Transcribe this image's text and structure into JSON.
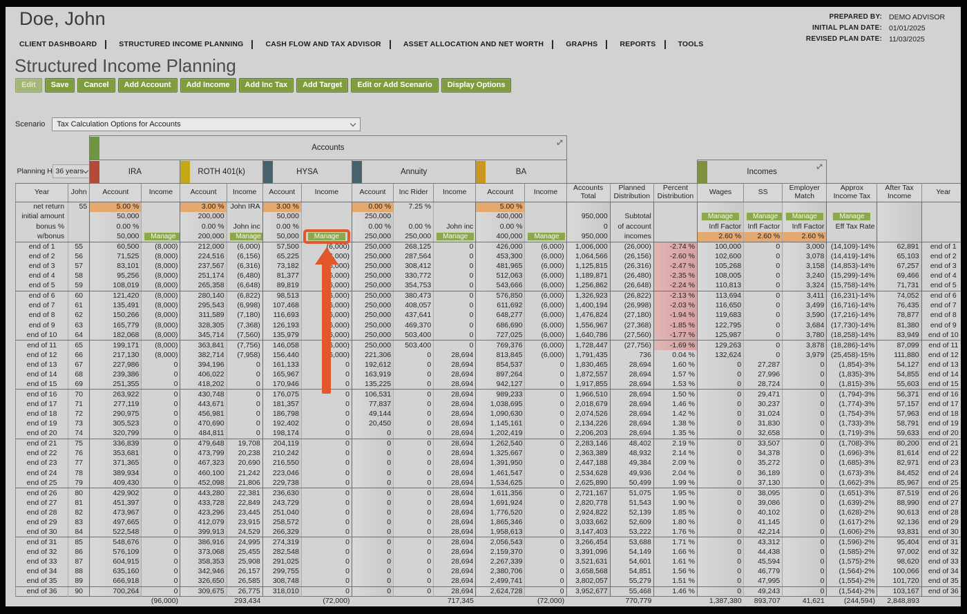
{
  "window": {
    "title": "Doe, John"
  },
  "plan_meta": {
    "prepared_by_label": "PREPARED BY:",
    "prepared_by": "DEMO ADVISOR",
    "initial_plan_label": "INITIAL PLAN DATE:",
    "initial_plan_date": "01/01/2025",
    "revised_plan_label": "REVISED PLAN DATE:",
    "revised_plan_date": "11/03/2025"
  },
  "nav": {
    "items": [
      "CLIENT DASHBOARD",
      "STRUCTURED INCOME PLANNING",
      "CASH FLOW AND TAX ADVISOR",
      "ASSET ALLOCATION AND NET WORTH",
      "GRAPHS",
      "REPORTS",
      "TOOLS"
    ]
  },
  "page": {
    "title": "Structured Income Planning"
  },
  "toolbar": {
    "buttons": [
      {
        "label": "Edit",
        "disabled": true
      },
      {
        "label": "Save",
        "disabled": false
      },
      {
        "label": "Cancel",
        "disabled": false
      },
      {
        "label": "Add Account",
        "disabled": false
      },
      {
        "label": "Add Income",
        "disabled": false
      },
      {
        "label": "Add Inc Tax",
        "disabled": false
      },
      {
        "label": "Add Target",
        "disabled": false
      },
      {
        "label": "Edit or Add Scenario",
        "disabled": false
      },
      {
        "label": "Display Options",
        "disabled": false
      }
    ]
  },
  "scenario": {
    "label": "Scenario",
    "value": "Tax Calculation Options for Accounts"
  },
  "planning_horizon": {
    "label": "Planning Horizon",
    "value": "36 years"
  },
  "table": {
    "accounts_group_label": "Accounts",
    "incomes_group_label": "Incomes",
    "account_names": [
      "IRA",
      "ROTH 401(k)",
      "HYSA",
      "Annuity",
      "BA"
    ],
    "column_headers": [
      "Year",
      "John",
      "Account",
      "Income",
      "Account",
      "Income",
      "Account",
      "Income",
      "Account",
      "Inc Rider",
      "Income",
      "Account",
      "Income",
      "Accounts Total",
      "Planned Distribution",
      "Percent Distribution",
      "Wages",
      "SS",
      "Employer Match",
      "Approx Income Tax",
      "After Tax Income",
      "Year"
    ],
    "manage_label": "Manage",
    "special_rows": [
      [
        "net return",
        "55",
        "5.00 %",
        "",
        "3.00 %",
        "John IRA",
        "3.00 %",
        "",
        "0.00 %",
        "7.25 %",
        "",
        "5.00 %",
        "",
        "",
        "",
        "",
        "",
        "",
        "",
        "",
        "",
        ""
      ],
      [
        "initial amount",
        "",
        "50,000",
        "",
        "200,000",
        "",
        "50,000",
        "",
        "250,000",
        "",
        "",
        "400,000",
        "",
        "950,000",
        "Subtotal",
        "",
        "Manage",
        "Manage",
        "Manage",
        "Manage",
        "",
        ""
      ],
      [
        "bonus %",
        "",
        "0.00 %",
        "",
        "0.00 %",
        "John inc",
        "0.00 %",
        "",
        "0.00 %",
        "0.00 %",
        "John inc",
        "0.00 %",
        "",
        "0",
        "of account",
        "",
        "Infl Factor",
        "Infl Factor",
        "Infl Factor",
        "Eff Tax Rate",
        "",
        ""
      ],
      [
        "w/bonus",
        "",
        "50,000",
        "Manage",
        "200,000",
        "Manage",
        "50,000",
        "Manage",
        "250,000",
        "250,000",
        "Manage",
        "400,000",
        "Manage",
        "950,000",
        "incomes",
        "",
        "2.60 %",
        "2.60 %",
        "2.60 %",
        "",
        "",
        ""
      ]
    ],
    "rows": [
      [
        "end of 1",
        "55",
        "60,500",
        "(8,000)",
        "212,000",
        "(6,000)",
        "57,500",
        "(6,000)",
        "250,000",
        "268,125",
        "0",
        "426,000",
        "(6,000)",
        "1,006,000",
        "(26,000)",
        "-2.74 %",
        "100,000",
        "0",
        "3,000",
        "(14,109)-14%",
        "62,891",
        "end of 1"
      ],
      [
        "end of 2",
        "56",
        "71,525",
        "(8,000)",
        "224,516",
        "(6,156)",
        "65,225",
        "(6,000)",
        "250,000",
        "287,564",
        "0",
        "453,300",
        "(6,000)",
        "1,064,566",
        "(26,156)",
        "-2.60 %",
        "102,600",
        "0",
        "3,078",
        "(14,419)-14%",
        "65,103",
        "end of 2"
      ],
      [
        "end of 3",
        "57",
        "83,101",
        "(8,000)",
        "237,567",
        "(6,316)",
        "73,182",
        "(6,000)",
        "250,000",
        "308,412",
        "0",
        "481,965",
        "(6,000)",
        "1,125,815",
        "(26,316)",
        "-2.47 %",
        "105,268",
        "0",
        "3,158",
        "(14,853)-14%",
        "67,257",
        "end of 3"
      ],
      [
        "end of 4",
        "58",
        "95,256",
        "(8,000)",
        "251,174",
        "(6,480)",
        "81,377",
        "(6,000)",
        "250,000",
        "330,772",
        "0",
        "512,063",
        "(6,000)",
        "1,189,871",
        "(26,480)",
        "-2.35 %",
        "108,005",
        "0",
        "3,240",
        "(15,299)-14%",
        "69,466",
        "end of 4"
      ],
      [
        "end of 5",
        "59",
        "108,019",
        "(8,000)",
        "265,358",
        "(6,648)",
        "89,819",
        "(6,000)",
        "250,000",
        "354,753",
        "0",
        "543,666",
        "(6,000)",
        "1,256,862",
        "(26,648)",
        "-2.24 %",
        "110,813",
        "0",
        "3,324",
        "(15,758)-14%",
        "71,731",
        "end of 5"
      ],
      [
        "end of 6",
        "60",
        "121,420",
        "(8,000)",
        "280,140",
        "(6,822)",
        "98,513",
        "(6,000)",
        "250,000",
        "380,473",
        "0",
        "576,850",
        "(6,000)",
        "1,326,923",
        "(26,822)",
        "-2.13 %",
        "113,694",
        "0",
        "3,411",
        "(16,231)-14%",
        "74,052",
        "end of 6"
      ],
      [
        "end of 7",
        "61",
        "135,491",
        "(8,000)",
        "295,543",
        "(6,998)",
        "107,468",
        "(6,000)",
        "250,000",
        "408,057",
        "0",
        "611,692",
        "(6,000)",
        "1,400,194",
        "(26,998)",
        "-2.03 %",
        "116,650",
        "0",
        "3,499",
        "(16,716)-14%",
        "76,435",
        "end of 7"
      ],
      [
        "end of 8",
        "62",
        "150,266",
        "(8,000)",
        "311,589",
        "(7,180)",
        "116,693",
        "(6,000)",
        "250,000",
        "437,641",
        "0",
        "648,277",
        "(6,000)",
        "1,476,824",
        "(27,180)",
        "-1.94 %",
        "119,683",
        "0",
        "3,590",
        "(17,216)-14%",
        "78,877",
        "end of 8"
      ],
      [
        "end of 9",
        "63",
        "165,779",
        "(8,000)",
        "328,305",
        "(7,368)",
        "126,193",
        "(6,000)",
        "250,000",
        "469,370",
        "0",
        "686,690",
        "(6,000)",
        "1,556,967",
        "(27,368)",
        "-1.85 %",
        "122,795",
        "0",
        "3,684",
        "(17,730)-14%",
        "81,380",
        "end of 9"
      ],
      [
        "end of 10",
        "64",
        "182,068",
        "(8,000)",
        "345,714",
        "(7,560)",
        "135,979",
        "(6,000)",
        "250,000",
        "503,400",
        "0",
        "727,025",
        "(6,000)",
        "1,640,786",
        "(27,560)",
        "-1.77 %",
        "125,987",
        "0",
        "3,780",
        "(18,258)-14%",
        "83,949",
        "end of 10"
      ],
      [
        "end of 11",
        "65",
        "199,171",
        "(8,000)",
        "363,841",
        "(7,756)",
        "146,058",
        "(6,000)",
        "250,000",
        "503,400",
        "0",
        "769,376",
        "(6,000)",
        "1,728,447",
        "(27,756)",
        "-1.69 %",
        "129,263",
        "0",
        "3,878",
        "(18,286)-14%",
        "87,099",
        "end of 11"
      ],
      [
        "end of 12",
        "66",
        "217,130",
        "(8,000)",
        "382,714",
        "(7,958)",
        "156,440",
        "(6,000)",
        "221,306",
        "0",
        "28,694",
        "813,845",
        "(6,000)",
        "1,791,435",
        "736",
        "0.04 %",
        "132,624",
        "0",
        "3,979",
        "(25,458)-15%",
        "111,880",
        "end of 12"
      ],
      [
        "end of 13",
        "67",
        "227,986",
        "0",
        "394,196",
        "0",
        "161,133",
        "0",
        "192,612",
        "0",
        "28,694",
        "854,537",
        "0",
        "1,830,465",
        "28,694",
        "1.60 %",
        "0",
        "27,287",
        "0",
        "(1,854)-3%",
        "54,127",
        "end of 13"
      ],
      [
        "end of 14",
        "68",
        "239,386",
        "0",
        "406,022",
        "0",
        "165,967",
        "0",
        "163,919",
        "0",
        "28,694",
        "897,264",
        "0",
        "1,872,557",
        "28,694",
        "1.57 %",
        "0",
        "27,996",
        "0",
        "(1,835)-3%",
        "54,855",
        "end of 14"
      ],
      [
        "end of 15",
        "69",
        "251,355",
        "0",
        "418,202",
        "0",
        "170,946",
        "0",
        "135,225",
        "0",
        "28,694",
        "942,127",
        "0",
        "1,917,855",
        "28,694",
        "1.53 %",
        "0",
        "28,724",
        "0",
        "(1,815)-3%",
        "55,603",
        "end of 15"
      ],
      [
        "end of 16",
        "70",
        "263,922",
        "0",
        "430,748",
        "0",
        "176,075",
        "0",
        "106,531",
        "0",
        "28,694",
        "989,233",
        "0",
        "1,966,510",
        "28,694",
        "1.50 %",
        "0",
        "29,471",
        "0",
        "(1,794)-3%",
        "56,371",
        "end of 16"
      ],
      [
        "end of 17",
        "71",
        "277,119",
        "0",
        "443,671",
        "0",
        "181,357",
        "0",
        "77,837",
        "0",
        "28,694",
        "1,038,695",
        "0",
        "2,018,679",
        "28,694",
        "1.46 %",
        "0",
        "30,237",
        "0",
        "(1,774)-3%",
        "57,157",
        "end of 17"
      ],
      [
        "end of 18",
        "72",
        "290,975",
        "0",
        "456,981",
        "0",
        "186,798",
        "0",
        "49,144",
        "0",
        "28,694",
        "1,090,630",
        "0",
        "2,074,526",
        "28,694",
        "1.42 %",
        "0",
        "31,024",
        "0",
        "(1,754)-3%",
        "57,963",
        "end of 18"
      ],
      [
        "end of 19",
        "73",
        "305,523",
        "0",
        "470,690",
        "0",
        "192,402",
        "0",
        "20,450",
        "0",
        "28,694",
        "1,145,161",
        "0",
        "2,134,226",
        "28,694",
        "1.38 %",
        "0",
        "31,830",
        "0",
        "(1,733)-3%",
        "58,791",
        "end of 19"
      ],
      [
        "end of 20",
        "74",
        "320,799",
        "0",
        "484,811",
        "0",
        "198,174",
        "0",
        "0",
        "0",
        "28,694",
        "1,202,419",
        "0",
        "2,206,203",
        "28,694",
        "1.35 %",
        "0",
        "32,658",
        "0",
        "(1,719)-3%",
        "59,633",
        "end of 20"
      ],
      [
        "end of 21",
        "75",
        "336,839",
        "0",
        "479,648",
        "19,708",
        "204,119",
        "0",
        "0",
        "0",
        "28,694",
        "1,262,540",
        "0",
        "2,283,146",
        "48,402",
        "2.19 %",
        "0",
        "33,507",
        "0",
        "(1,708)-3%",
        "80,200",
        "end of 21"
      ],
      [
        "end of 22",
        "76",
        "353,681",
        "0",
        "473,799",
        "20,238",
        "210,242",
        "0",
        "0",
        "0",
        "28,694",
        "1,325,667",
        "0",
        "2,363,389",
        "48,932",
        "2.14 %",
        "0",
        "34,378",
        "0",
        "(1,696)-3%",
        "81,614",
        "end of 22"
      ],
      [
        "end of 23",
        "77",
        "371,365",
        "0",
        "467,323",
        "20,690",
        "216,550",
        "0",
        "0",
        "0",
        "28,694",
        "1,391,950",
        "0",
        "2,447,188",
        "49,384",
        "2.09 %",
        "0",
        "35,272",
        "0",
        "(1,685)-3%",
        "82,971",
        "end of 23"
      ],
      [
        "end of 24",
        "78",
        "389,934",
        "0",
        "460,100",
        "21,242",
        "223,046",
        "0",
        "0",
        "0",
        "28,694",
        "1,461,547",
        "0",
        "2,534,628",
        "49,936",
        "2.04 %",
        "0",
        "36,189",
        "0",
        "(1,673)-3%",
        "84,452",
        "end of 24"
      ],
      [
        "end of 25",
        "79",
        "409,430",
        "0",
        "452,098",
        "21,806",
        "229,738",
        "0",
        "0",
        "0",
        "28,694",
        "1,534,625",
        "0",
        "2,625,890",
        "50,499",
        "1.99 %",
        "0",
        "37,130",
        "0",
        "(1,662)-3%",
        "85,967",
        "end of 25"
      ],
      [
        "end of 26",
        "80",
        "429,902",
        "0",
        "443,280",
        "22,381",
        "236,630",
        "0",
        "0",
        "0",
        "28,694",
        "1,611,356",
        "0",
        "2,721,167",
        "51,075",
        "1.95 %",
        "0",
        "38,095",
        "0",
        "(1,651)-3%",
        "87,519",
        "end of 26"
      ],
      [
        "end of 27",
        "81",
        "451,397",
        "0",
        "433,728",
        "22,849",
        "243,729",
        "0",
        "0",
        "0",
        "28,694",
        "1,691,924",
        "0",
        "2,820,778",
        "51,543",
        "1.90 %",
        "0",
        "39,086",
        "0",
        "(1,639)-2%",
        "88,990",
        "end of 27"
      ],
      [
        "end of 28",
        "82",
        "473,967",
        "0",
        "423,296",
        "23,445",
        "251,040",
        "0",
        "0",
        "0",
        "28,694",
        "1,776,520",
        "0",
        "2,924,822",
        "52,139",
        "1.85 %",
        "0",
        "40,102",
        "0",
        "(1,628)-2%",
        "90,613",
        "end of 28"
      ],
      [
        "end of 29",
        "83",
        "497,665",
        "0",
        "412,079",
        "23,915",
        "258,572",
        "0",
        "0",
        "0",
        "28,694",
        "1,865,346",
        "0",
        "3,033,662",
        "52,609",
        "1.80 %",
        "0",
        "41,145",
        "0",
        "(1,617)-2%",
        "92,136",
        "end of 29"
      ],
      [
        "end of 30",
        "84",
        "522,548",
        "0",
        "399,913",
        "24,529",
        "266,329",
        "0",
        "0",
        "0",
        "28,694",
        "1,958,613",
        "0",
        "3,147,403",
        "53,222",
        "1.76 %",
        "0",
        "42,214",
        "0",
        "(1,606)-2%",
        "93,831",
        "end of 30"
      ],
      [
        "end of 31",
        "85",
        "548,676",
        "0",
        "386,916",
        "24,995",
        "274,319",
        "0",
        "0",
        "0",
        "28,694",
        "2,056,543",
        "0",
        "3,266,454",
        "53,688",
        "1.71 %",
        "0",
        "43,312",
        "0",
        "(1,596)-2%",
        "95,404",
        "end of 31"
      ],
      [
        "end of 32",
        "86",
        "576,109",
        "0",
        "373,068",
        "25,455",
        "282,548",
        "0",
        "0",
        "0",
        "28,694",
        "2,159,370",
        "0",
        "3,391,096",
        "54,149",
        "1.66 %",
        "0",
        "44,438",
        "0",
        "(1,585)-2%",
        "97,002",
        "end of 32"
      ],
      [
        "end of 33",
        "87",
        "604,915",
        "0",
        "358,353",
        "25,908",
        "291,025",
        "0",
        "0",
        "0",
        "28,694",
        "2,267,339",
        "0",
        "3,521,631",
        "54,601",
        "1.61 %",
        "0",
        "45,594",
        "0",
        "(1,575)-2%",
        "98,620",
        "end of 33"
      ],
      [
        "end of 34",
        "88",
        "635,160",
        "0",
        "342,946",
        "26,157",
        "299,755",
        "0",
        "0",
        "0",
        "28,694",
        "2,380,706",
        "0",
        "3,658,568",
        "54,851",
        "1.56 %",
        "0",
        "46,779",
        "0",
        "(1,564)-2%",
        "100,066",
        "end of 34"
      ],
      [
        "end of 35",
        "89",
        "666,918",
        "0",
        "326,650",
        "26,585",
        "308,748",
        "0",
        "0",
        "0",
        "28,694",
        "2,499,741",
        "0",
        "3,802,057",
        "55,279",
        "1.51 %",
        "0",
        "47,995",
        "0",
        "(1,554)-2%",
        "101,720",
        "end of 35"
      ],
      [
        "end of 36",
        "90",
        "700,264",
        "0",
        "309,675",
        "26,775",
        "318,010",
        "0",
        "0",
        "0",
        "28,694",
        "2,624,728",
        "0",
        "3,952,677",
        "55,468",
        "1.46 %",
        "0",
        "49,243",
        "0",
        "(1,544)-2%",
        "103,167",
        "end of 36"
      ]
    ],
    "totals_row": [
      "",
      "",
      "",
      "(96,000)",
      "",
      "293,434",
      "",
      "(72,000)",
      "",
      "",
      "717,345",
      "",
      "(72,000)",
      "",
      "770,779",
      "",
      "1,387,380",
      "893,707",
      "41,621",
      "(244,594)",
      "2,848,893",
      ""
    ]
  },
  "annotation": {
    "shape": "box-and-arrow",
    "target": "hysa-income-manage-button",
    "color": "#e2572b"
  },
  "colors": {
    "page_background": "#d2d2d2",
    "button_green": "#7e9d3e",
    "manage_green": "#8ca84c",
    "tab_accounts": "#6f9442",
    "tab_ira": "#b44b38",
    "tab_roth": "#c3aa14",
    "tab_hysa": "#47616e",
    "tab_annuity": "#47616e",
    "tab_ba": "#c99722",
    "tab_incomes": "#7d9140",
    "negative_percent_pink": "#ddabab",
    "rate_cell_tan": "#e5a96f",
    "annotation_orange": "#e2572b"
  }
}
